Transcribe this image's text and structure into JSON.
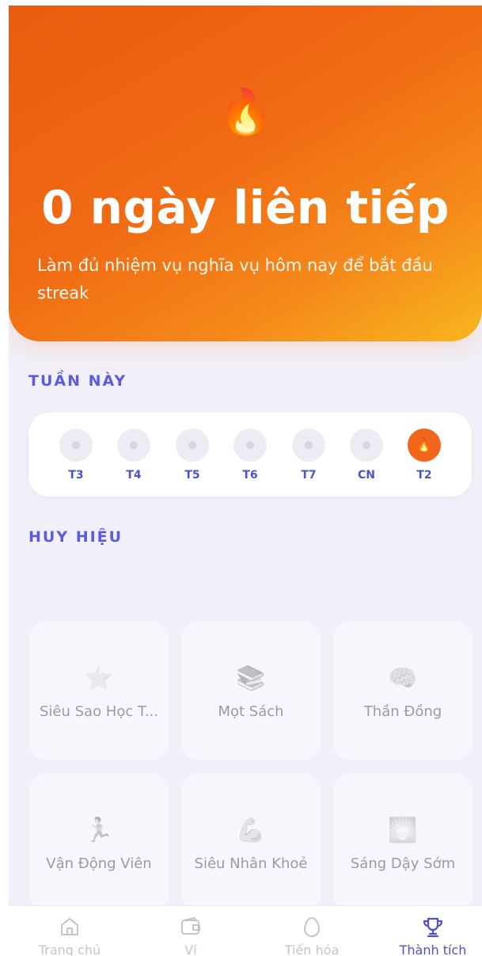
{
  "hero": {
    "flame_emoji": "🔥",
    "title": "0 ngày liên tiếp",
    "subtitle": "Làm đủ nhiệm vụ nghĩa vụ hôm nay để bắt đầu streak"
  },
  "week": {
    "title": "TUẦN NÀY",
    "days": [
      {
        "label": "T3",
        "active": false
      },
      {
        "label": "T4",
        "active": false
      },
      {
        "label": "T5",
        "active": false
      },
      {
        "label": "T6",
        "active": false
      },
      {
        "label": "T7",
        "active": false
      },
      {
        "label": "CN",
        "active": false
      },
      {
        "label": "T2",
        "active": true,
        "icon": "🔥"
      }
    ]
  },
  "badges": {
    "title": "HUY HIỆU",
    "items": [
      {
        "icon": "⭐",
        "icon_name": "star-icon",
        "name": "Siêu Sao Học T..."
      },
      {
        "icon": "📚",
        "icon_name": "books-icon",
        "name": "Mọt Sách"
      },
      {
        "icon": "🧠",
        "icon_name": "brain-icon",
        "name": "Thần Đồng"
      },
      {
        "icon": "🏃",
        "icon_name": "runner-icon",
        "name": "Vận Động Viên"
      },
      {
        "icon": "💪",
        "icon_name": "flexed-biceps-icon",
        "name": "Siêu Nhân Khoẻ"
      },
      {
        "icon": "🌅",
        "icon_name": "sunrise-icon",
        "name": "Sáng Dậy Sớm"
      }
    ]
  },
  "tabbar": {
    "tabs": [
      {
        "label": "Trang chủ",
        "icon": "home-icon",
        "active": false
      },
      {
        "label": "Ví",
        "icon": "wallet-icon",
        "active": false
      },
      {
        "label": "Tiến hóa",
        "icon": "egg-icon",
        "active": false
      },
      {
        "label": "Thành tích",
        "icon": "trophy-icon",
        "active": true
      }
    ]
  },
  "colors": {
    "accent": "#5b5be0",
    "hero_start": "#ea5b10",
    "hero_end": "#f8b51f",
    "streak_active": "#f2661b"
  }
}
